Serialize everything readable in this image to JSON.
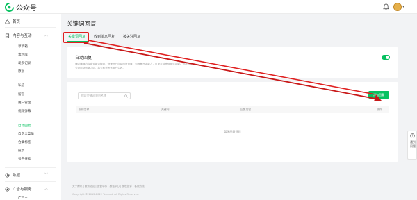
{
  "app": {
    "name": "公众号"
  },
  "colors": {
    "brand": "#07c160",
    "annotation": "#e02020",
    "link": "#576b95"
  },
  "header": {
    "icons": [
      "bell-icon",
      "avatar",
      "chevron-down-icon"
    ]
  },
  "sidebar": {
    "home": "首页",
    "content_section": "内容与互动",
    "content_items": [
      "草稿箱",
      "素材库",
      "发表记录",
      "原创"
    ],
    "interaction_items": [
      "私信",
      "留言",
      "用户管理",
      "视频弹幕"
    ],
    "feature_items": [
      "自动回复",
      "自定义菜单",
      "合集标签",
      "投票",
      "号内搜索"
    ],
    "data_section": "数据",
    "ads_section": "广告与服务",
    "ads_items": [
      "广告主"
    ]
  },
  "main": {
    "title": "关键词回复",
    "tabs": [
      "关键词回复",
      "收到消息回复",
      "被关注回复"
    ],
    "auto_reply": {
      "title": "自动回复",
      "desc_line1": "通过编辑内容或关键词规则，快速进行自动回复设置。如具备开发能力，可更灵活地使用该功能。查看详情",
      "desc_line2": "关闭自动回复之后，将立即对所有用户生效。",
      "enabled": true
    },
    "rules": {
      "search_placeholder": "搜索关键词/规则名称",
      "add_button": "添加回复",
      "columns": [
        "规则名称",
        "关键词",
        "回复内容",
        "操作"
      ],
      "empty_text": "暂无回复规则"
    }
  },
  "footer": {
    "links": "关于腾讯  |  服务协议  |  运营中心  |  辟谣中心  |  侵权投诉  |  客服热线",
    "copyright": "Copyright © 2012-2022 Tencent. All Rights Reserved."
  },
  "floating": {
    "label": "遇到问题"
  }
}
